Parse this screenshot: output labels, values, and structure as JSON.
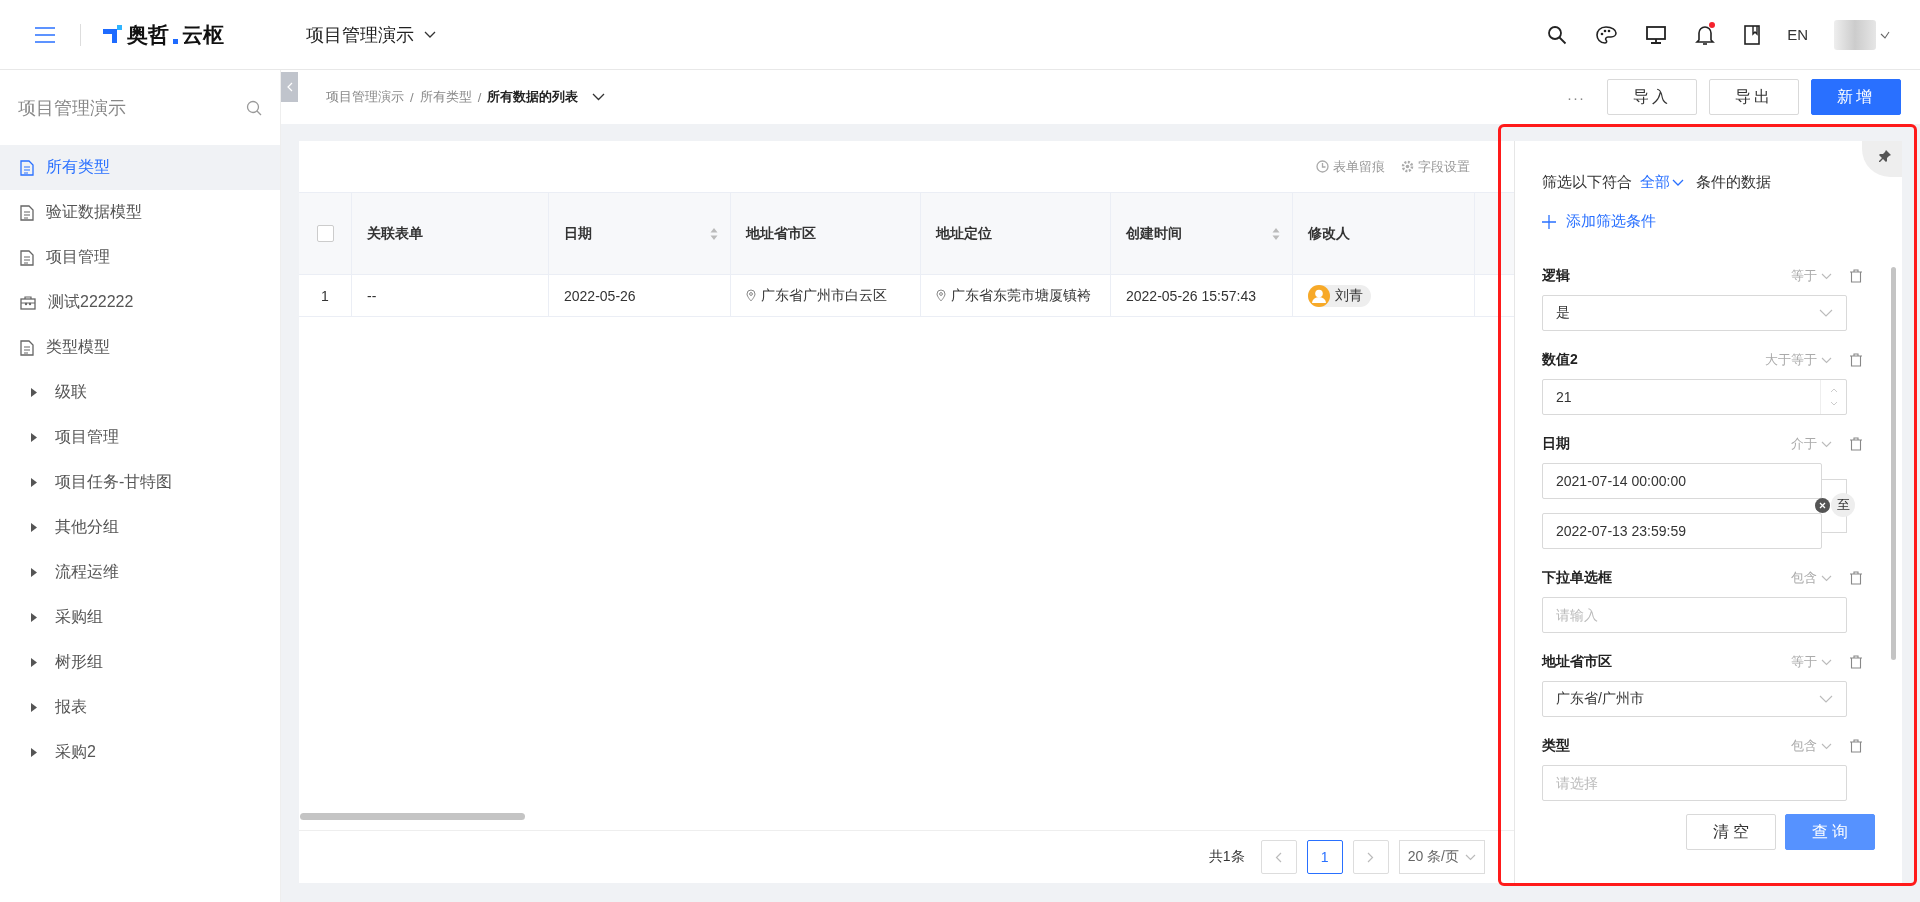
{
  "header": {
    "logo": [
      "奥哲",
      "云枢"
    ],
    "app_switcher": "项目管理演示",
    "notifications_unread": true,
    "language": "EN"
  },
  "sidebar": {
    "title": "项目管理演示",
    "items": [
      {
        "label": "所有类型",
        "kind": "doc",
        "selected": true
      },
      {
        "label": "验证数据模型",
        "kind": "doc",
        "selected": false
      },
      {
        "label": "项目管理",
        "kind": "doc",
        "selected": false
      },
      {
        "label": "测试222222",
        "kind": "box",
        "selected": false
      },
      {
        "label": "类型模型",
        "kind": "doc",
        "selected": false
      },
      {
        "label": "级联",
        "kind": "group",
        "selected": false
      },
      {
        "label": "项目管理",
        "kind": "group",
        "selected": false
      },
      {
        "label": "项目任务-甘特图",
        "kind": "group",
        "selected": false
      },
      {
        "label": "其他分组",
        "kind": "group",
        "selected": false
      },
      {
        "label": "流程运维",
        "kind": "group",
        "selected": false
      },
      {
        "label": "采购组",
        "kind": "group",
        "selected": false
      },
      {
        "label": "树形组",
        "kind": "group",
        "selected": false
      },
      {
        "label": "报表",
        "kind": "group",
        "selected": false
      },
      {
        "label": "采购2",
        "kind": "group",
        "selected": false
      }
    ]
  },
  "breadcrumb": [
    "项目管理演示",
    "所有类型",
    "所有数据的列表"
  ],
  "breadcrumb_separator": "/",
  "actions": {
    "more": "···",
    "buttons": [
      {
        "label": "导入",
        "primary": false
      },
      {
        "label": "导出",
        "primary": false
      },
      {
        "label": "新增",
        "primary": true
      }
    ]
  },
  "table_tools": [
    "表单留痕",
    "字段设置"
  ],
  "table": {
    "select_all_checked": false,
    "columns": [
      {
        "label": "关联表单",
        "sortable": false
      },
      {
        "label": "日期",
        "sortable": true
      },
      {
        "label": "地址省市区",
        "sortable": false
      },
      {
        "label": "地址定位",
        "sortable": false
      },
      {
        "label": "创建时间",
        "sortable": true
      },
      {
        "label": "修改人",
        "sortable": false
      }
    ],
    "rows": [
      {
        "index": "1",
        "cells": [
          {
            "kind": "text",
            "text": "--"
          },
          {
            "kind": "text",
            "text": "2022-05-26"
          },
          {
            "kind": "location",
            "text": "广东省广州市白云区"
          },
          {
            "kind": "location",
            "text": "广东省东莞市塘厦镇袴"
          },
          {
            "kind": "text",
            "text": "2022-05-26 15:57:43"
          },
          {
            "kind": "user",
            "text": "刘青"
          }
        ]
      }
    ]
  },
  "pagination": {
    "total": "共1条",
    "pages": [
      {
        "label": "1",
        "selected": true
      }
    ],
    "page_size": "20 条/页"
  },
  "filter": {
    "intro": "筛选以下符合",
    "match": "全部",
    "outro": "条件的数据",
    "add": "添加筛选条件",
    "conditions": [
      {
        "label": "逻辑",
        "operator": "等于",
        "kind": "select",
        "value": "是"
      },
      {
        "label": "数值2",
        "operator": "大于等于",
        "kind": "number",
        "value": "21"
      },
      {
        "label": "日期",
        "operator": "介于",
        "kind": "daterange",
        "start": "2021-07-14 00:00:00",
        "end": "2022-07-13 23:59:59",
        "separator": "至"
      },
      {
        "label": "下拉单选框",
        "operator": "包含",
        "kind": "input",
        "placeholder": "请输入"
      },
      {
        "label": "地址省市区",
        "operator": "等于",
        "kind": "select",
        "value": "广东省/广州市"
      },
      {
        "label": "类型",
        "operator": "包含",
        "kind": "input",
        "placeholder": "请选择"
      }
    ],
    "clear": "清 空",
    "query": "查 询"
  }
}
